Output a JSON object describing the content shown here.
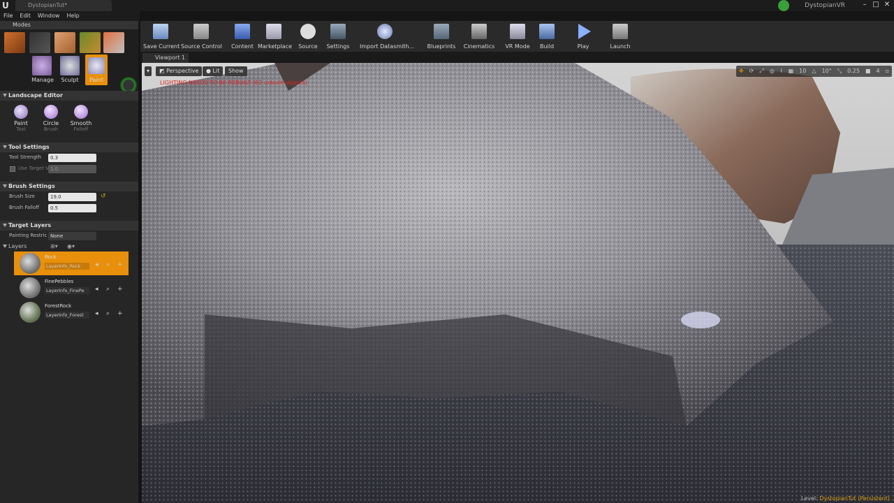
{
  "window": {
    "doc_tab": "DystopianTut*",
    "project": "DystopianVR"
  },
  "menu": [
    "File",
    "Edit",
    "Window",
    "Help"
  ],
  "modes": {
    "header": "Modes",
    "items": [
      "Manage",
      "Sculpt",
      "Paint"
    ]
  },
  "landscape": {
    "header": "Landscape Editor",
    "tools": [
      {
        "name": "Paint",
        "sub": "Tool"
      },
      {
        "name": "Circle",
        "sub": "Brush"
      },
      {
        "name": "Smooth",
        "sub": "Falloff"
      }
    ]
  },
  "tool_settings": {
    "header": "Tool Settings",
    "strength_label": "Tool Strength",
    "strength_value": "0.3",
    "target_label": "Use Target V",
    "target_value": "1.0"
  },
  "brush_settings": {
    "header": "Brush Settings",
    "size_label": "Brush Size",
    "size_value": "19.0",
    "falloff_label": "Brush Falloff",
    "falloff_value": "0.5"
  },
  "target_layers": {
    "header": "Target Layers",
    "restrict_label": "Painting Restric",
    "restrict_value": "None",
    "layers_label": "Layers",
    "layers": [
      {
        "name": "Rock",
        "info": "LayerInfo_Rock"
      },
      {
        "name": "FinePebbles",
        "info": "LayerInfo_FinePe"
      },
      {
        "name": "ForestRock",
        "info": "LayerInfo_Forest"
      }
    ]
  },
  "toolbar": [
    "Save Current",
    "Source Control",
    "Content",
    "Marketplace",
    "Source",
    "Settings",
    "Import Datasmith...",
    "Blueprints",
    "Cinematics",
    "VR Mode",
    "Build",
    "Play",
    "Launch"
  ],
  "viewport": {
    "tab": "Viewport 1",
    "perspective": "Perspective",
    "lit": "Lit",
    "show": "Show",
    "warning": "LIGHTING NEEDS TO BE REBUILT (62 unbuilt objects)",
    "grid": "10",
    "angle": "10°",
    "scale": "0.25",
    "speed": "4",
    "level_label": "Level:",
    "level_name": "DystopianTut (Persistent)"
  }
}
